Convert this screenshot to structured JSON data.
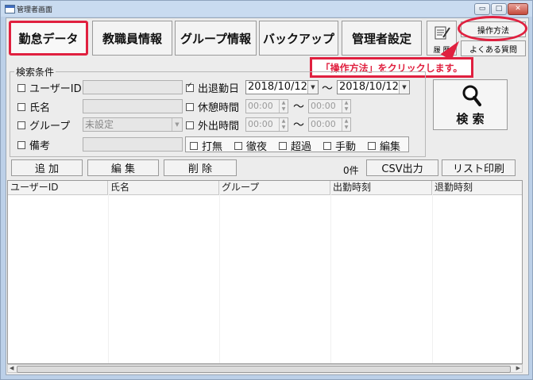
{
  "window": {
    "title": "管理者画面",
    "caption_buttons": [
      "▭",
      "□",
      "✕"
    ]
  },
  "nav_tabs": [
    {
      "label": "勤怠データ",
      "active": true
    },
    {
      "label": "教職員情報",
      "active": false
    },
    {
      "label": "グループ情報",
      "active": false
    },
    {
      "label": "バックアップ",
      "active": false
    },
    {
      "label": "管理者設定",
      "active": false
    }
  ],
  "toolbar": {
    "history_label": "履 歴",
    "howto_label": "操作方法",
    "faq_label": "よくある質問"
  },
  "annotation": {
    "callout": "「操作方法」をクリックします。",
    "accent_color": "#e0203f"
  },
  "search": {
    "group_label": "検索条件",
    "user_id_label": "ユーザーID",
    "name_label": "氏名",
    "group_field_label": "グループ",
    "group_value": "未設定",
    "memo_label": "備考",
    "attendance_date_label": "出退勤日",
    "date_from": "2018/10/12",
    "date_to": "2018/10/12",
    "tilde": "～",
    "rest_time_label": "休憩時間",
    "outing_time_label": "外出時間",
    "time_from": "00:00",
    "time_to": "00:00",
    "flags": [
      "打無",
      "徹夜",
      "超過",
      "手動",
      "編集"
    ],
    "search_button": "検 索"
  },
  "actions": {
    "add": "追 加",
    "edit": "編 集",
    "delete": "削 除",
    "count": "0件",
    "csv": "CSV出力",
    "print": "リスト印刷"
  },
  "table": {
    "columns": [
      "ユーザーID",
      "氏名",
      "グループ",
      "出勤時刻",
      "退勤時刻"
    ]
  }
}
